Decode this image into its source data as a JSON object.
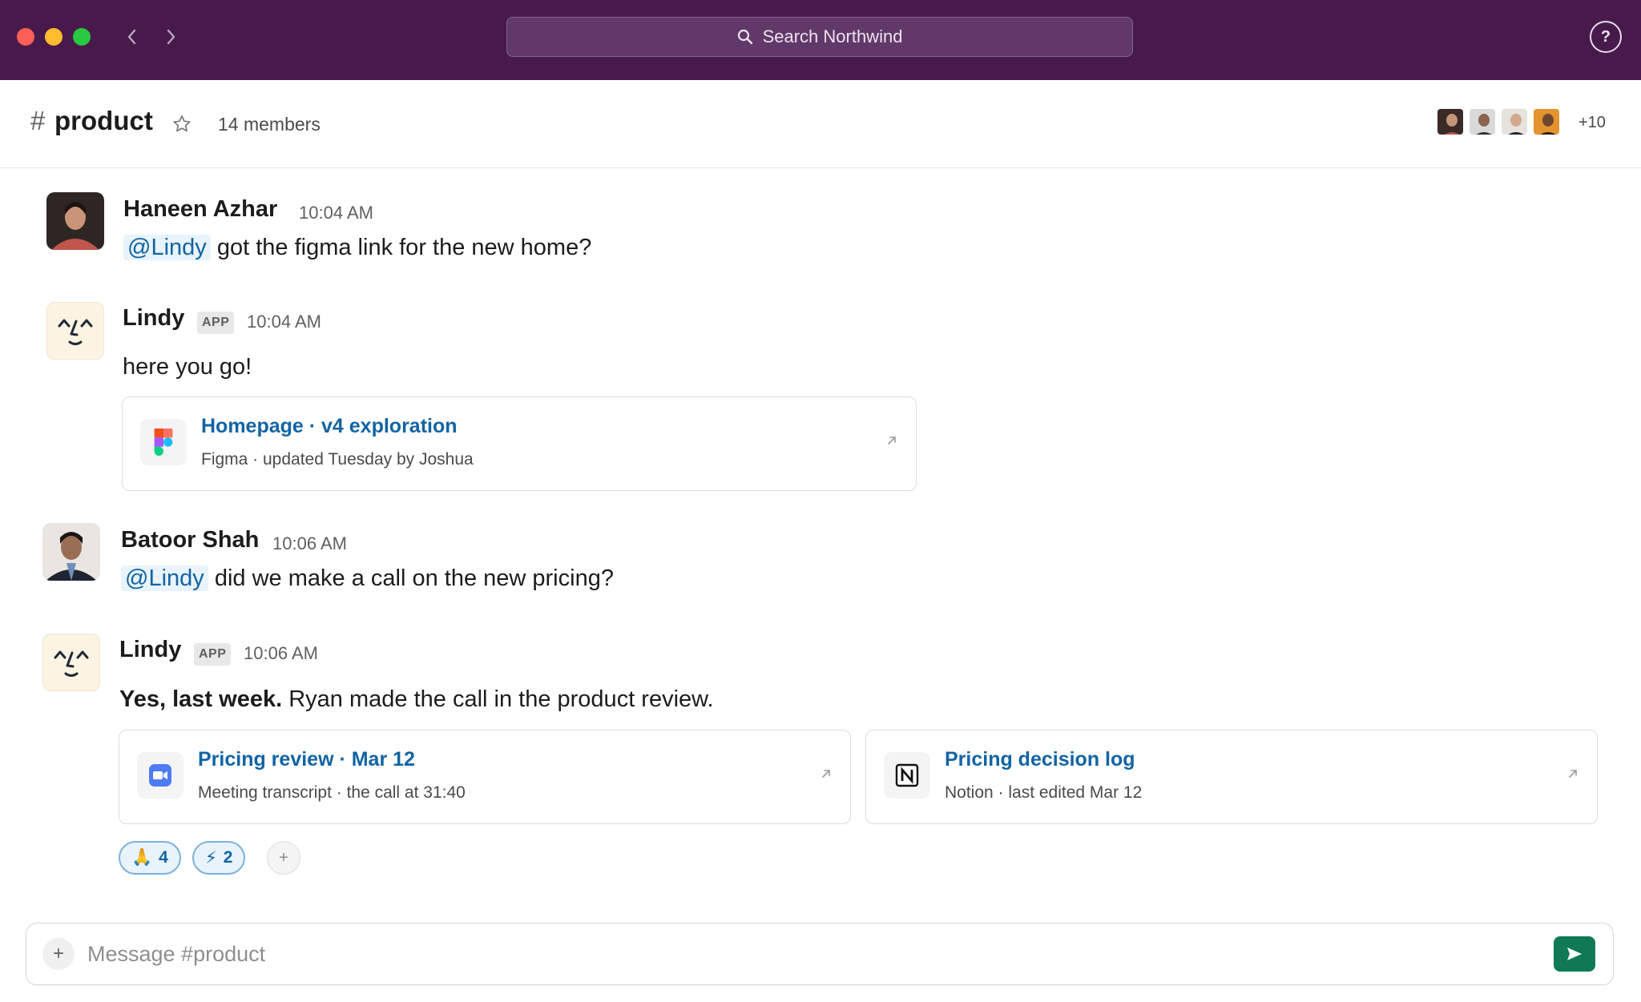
{
  "search": {
    "placeholder": "Search Northwind"
  },
  "help": {
    "label": "?"
  },
  "channel": {
    "hash": "#",
    "name": "product",
    "members_label": "14 members",
    "more_members": "+10"
  },
  "messages": [
    {
      "sender": "Haneen Azhar",
      "time": "10:04 AM",
      "mention": "@Lindy",
      "text": "got the figma link for the new home?"
    },
    {
      "sender": "Lindy",
      "badge": "APP",
      "time": "10:04 AM",
      "text": "here you go!",
      "card": {
        "title": "Homepage · v4 exploration",
        "subtitle": "Figma · updated Tuesday by Joshua",
        "icon": "figma-icon"
      }
    },
    {
      "sender": "Batoor Shah",
      "time": "10:06 AM",
      "mention": "@Lindy",
      "text": "did we make a call on the new pricing?"
    },
    {
      "sender": "Lindy",
      "badge": "APP",
      "time": "10:06 AM",
      "bold": "Yes, last week.",
      "text": "Ryan made the call in the product review.",
      "cards": [
        {
          "title": "Pricing review · Mar 12",
          "subtitle": "Meeting transcript · the call at 31:40",
          "icon": "video-camera-icon"
        },
        {
          "title": "Pricing decision log",
          "subtitle": "Notion · last edited Mar 12",
          "icon": "notion-icon"
        }
      ],
      "reactions": [
        {
          "emoji": "🙏",
          "count": "4"
        },
        {
          "emoji": "⚡",
          "count": "2"
        }
      ],
      "add_reaction": "+"
    }
  ],
  "composer": {
    "plus": "+",
    "placeholder": "Message #product"
  },
  "colors": {
    "titlebar": "#481a4c",
    "link": "#1264a3",
    "send": "#0f7a55",
    "mention_bg": "#e8f3fb"
  }
}
